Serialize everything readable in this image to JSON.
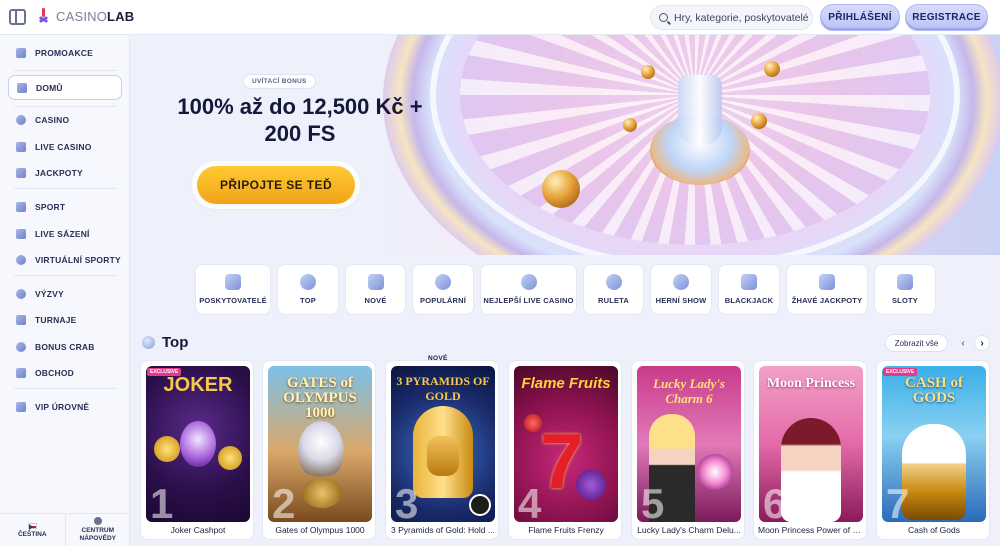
{
  "header": {
    "logo_light": "CASINO",
    "logo_bold": "LAB",
    "search_placeholder": "Hry, kategorie, poskytovatelé",
    "login_label": "PŘIHLÁŠENÍ",
    "register_label": "REGISTRACE"
  },
  "sidebar": {
    "items": [
      {
        "label": "PROMOAKCE",
        "icon": "gift-icon"
      },
      {
        "label": "DOMŮ",
        "icon": "home-icon",
        "active": true
      },
      {
        "label": "CASINO",
        "icon": "casino-chip-icon"
      },
      {
        "label": "LIVE CASINO",
        "icon": "live-cards-icon"
      },
      {
        "label": "JACKPOTY",
        "icon": "jackpot-icon"
      },
      {
        "label": "SPORT",
        "icon": "sport-icon"
      },
      {
        "label": "LIVE SÁZENÍ",
        "icon": "live-betting-icon"
      },
      {
        "label": "VIRTUÁLNÍ SPORTY",
        "icon": "virtual-sports-icon"
      },
      {
        "label": "VÝZVY",
        "icon": "challenge-icon"
      },
      {
        "label": "TURNAJE",
        "icon": "trophy-icon"
      },
      {
        "label": "BONUS CRAB",
        "icon": "crab-icon"
      },
      {
        "label": "OBCHOD",
        "icon": "shop-icon"
      },
      {
        "label": "VIP ÚROVNĚ",
        "icon": "vip-icon"
      }
    ],
    "language": "ČEŠTINA",
    "help": "CENTRUM NÁPOVĚDY"
  },
  "hero": {
    "badge": "UVÍTACÍ BONUS",
    "title": "100% až do 12,500 Kč + 200 FS",
    "cta": "PŘIPOJTE SE TEĎ"
  },
  "categories": [
    {
      "label": "POSKYTOVATELÉ",
      "icon": "funnel-icon"
    },
    {
      "label": "TOP",
      "icon": "star-badge-icon"
    },
    {
      "label": "NOVÉ",
      "icon": "new-badge-icon"
    },
    {
      "label": "POPULÁRNÍ",
      "icon": "star-icon"
    },
    {
      "label": "NEJLEPŠÍ LIVE CASINO",
      "icon": "live-casino-icon"
    },
    {
      "label": "RULETA",
      "icon": "roulette-icon"
    },
    {
      "label": "HERNÍ SHOW",
      "icon": "game-show-icon"
    },
    {
      "label": "BLACKJACK",
      "icon": "cards-icon"
    },
    {
      "label": "ŽHAVÉ JACKPOTY",
      "icon": "hot-jackpot-icon"
    },
    {
      "label": "SLOTY",
      "icon": "slots-icon"
    }
  ],
  "top_section": {
    "title": "Top",
    "view_all": "Zobrazit vše",
    "prev": "‹",
    "next": "›",
    "new_tag": "NOVÉ",
    "games": [
      {
        "rank": "1",
        "name": "Joker Cashpot",
        "art": "JOKER",
        "badge": "EXCLUSIVE"
      },
      {
        "rank": "2",
        "name": "Gates of Olympus 1000",
        "art": "GATES of OLYMPUS 1000"
      },
      {
        "rank": "3",
        "name": "3 Pyramids of Gold: Hold ...",
        "art": "3 PYRAMIDS OF GOLD"
      },
      {
        "rank": "4",
        "name": "Flame Fruits Frenzy",
        "art": "Flame Fruits"
      },
      {
        "rank": "5",
        "name": "Lucky Lady's Charm Delu...",
        "art": "Lucky Lady's Charm 6"
      },
      {
        "rank": "6",
        "name": "Moon Princess Power of L...",
        "art": "Moon Princess"
      },
      {
        "rank": "7",
        "name": "Cash of Gods",
        "art": "CASH of GODS",
        "badge": "EXCLUSIVE"
      }
    ]
  }
}
